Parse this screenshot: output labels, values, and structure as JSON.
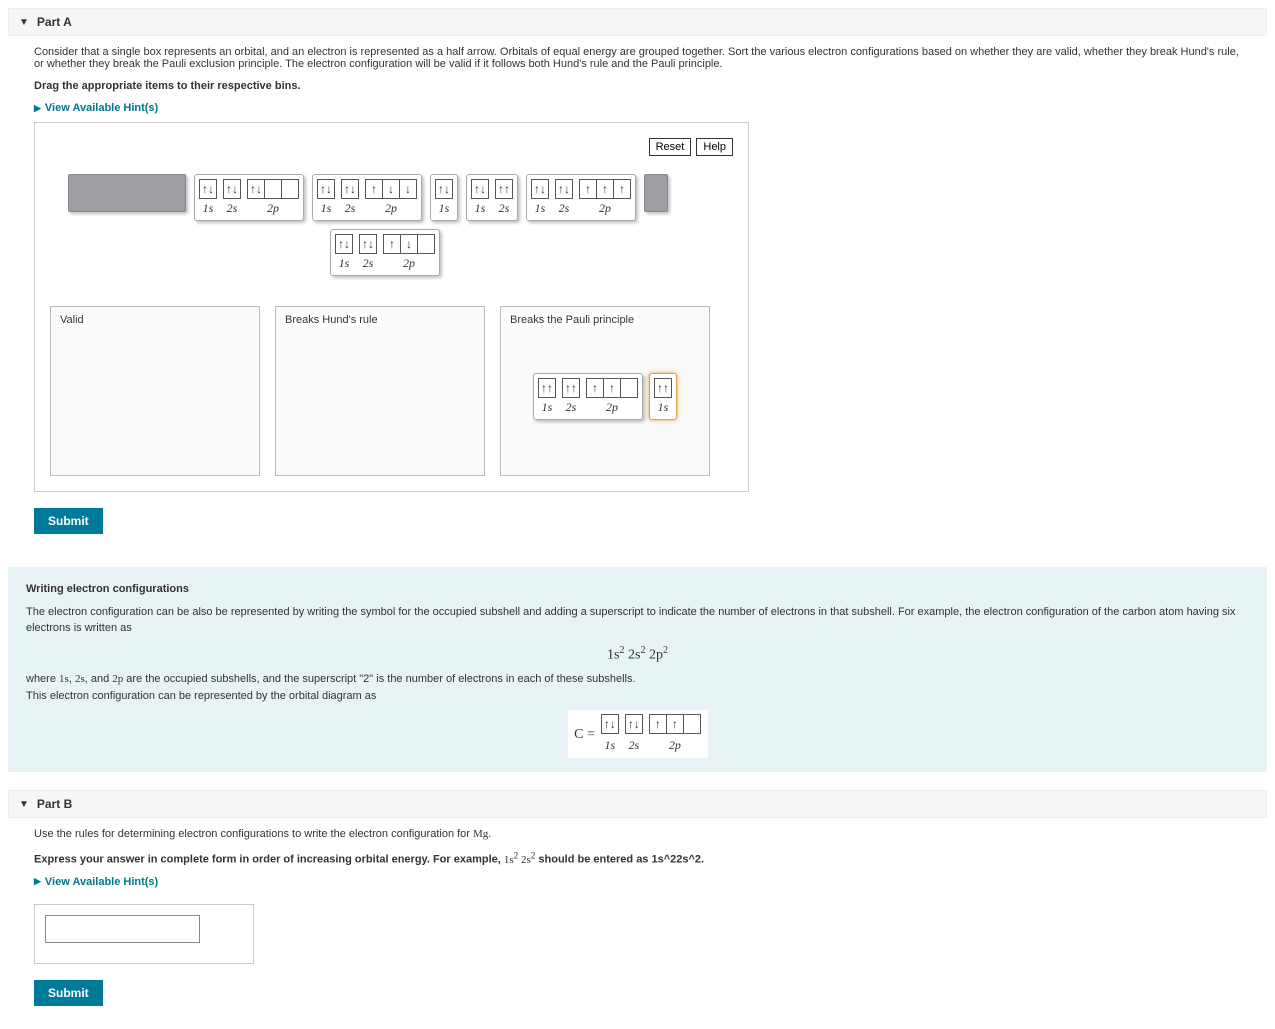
{
  "partA": {
    "title": "Part A",
    "prompt": "Consider that a single box represents an orbital, and an electron is represented as a half arrow. Orbitals of equal energy are grouped together. Sort the various electron configurations based on whether they are valid, whether they break Hund's rule, or whether they break the Pauli exclusion principle. The electron configuration will be valid if it follows both Hund's rule and the Pauli principle.",
    "instruction": "Drag the appropriate items to their respective bins.",
    "hint_label": "View Available Hint(s)",
    "reset_label": "Reset",
    "help_label": "Help",
    "bins": {
      "valid": "Valid",
      "hund": "Breaks Hund's rule",
      "pauli": "Breaks the Pauli principle"
    },
    "submit_label": "Submit"
  },
  "orbital_labels": {
    "s1": "1s",
    "s2": "2s",
    "p2": "2p"
  },
  "arrows": {
    "up": "↑",
    "down": "↓",
    "updown": "↑↓",
    "upup": "↑↑",
    "downdown": "↓↓"
  },
  "pool_items": [
    {
      "id": "cfg1",
      "shells": [
        {
          "label": "1s",
          "boxes": [
            "updown"
          ]
        },
        {
          "label": "2s",
          "boxes": [
            "updown"
          ]
        },
        {
          "label": "2p",
          "boxes": [
            "updown",
            "",
            ""
          ]
        }
      ]
    },
    {
      "id": "cfg2",
      "shells": [
        {
          "label": "1s",
          "boxes": [
            "updown"
          ]
        },
        {
          "label": "2s",
          "boxes": [
            "updown"
          ]
        },
        {
          "label": "2p",
          "boxes": [
            "up",
            "down",
            "down"
          ]
        }
      ]
    },
    {
      "id": "cfg3",
      "shells": [
        {
          "label": "1s",
          "boxes": [
            "updown"
          ]
        }
      ]
    },
    {
      "id": "cfg4",
      "shells": [
        {
          "label": "1s",
          "boxes": [
            "updown"
          ]
        },
        {
          "label": "2s",
          "boxes": [
            "upup"
          ]
        }
      ]
    },
    {
      "id": "cfg5",
      "shells": [
        {
          "label": "1s",
          "boxes": [
            "updown"
          ]
        },
        {
          "label": "2s",
          "boxes": [
            "updown"
          ]
        },
        {
          "label": "2p",
          "boxes": [
            "up",
            "up",
            "up"
          ]
        }
      ]
    },
    {
      "id": "cfg6",
      "shells": [
        {
          "label": "1s",
          "boxes": [
            "updown"
          ]
        },
        {
          "label": "2s",
          "boxes": [
            "updown"
          ]
        },
        {
          "label": "2p",
          "boxes": [
            "up",
            "down",
            ""
          ]
        }
      ]
    }
  ],
  "dropped_pauli": [
    {
      "id": "d1",
      "shells": [
        {
          "label": "1s",
          "boxes": [
            "upup"
          ]
        },
        {
          "label": "2s",
          "boxes": [
            "upup"
          ]
        },
        {
          "label": "2p",
          "boxes": [
            "up",
            "up",
            ""
          ]
        }
      ]
    },
    {
      "id": "d2",
      "selected": true,
      "shells": [
        {
          "label": "1s",
          "boxes": [
            "upup"
          ]
        }
      ]
    }
  ],
  "info": {
    "title": "Writing electron configurations",
    "p1": "The electron configuration can be also be represented by writing the symbol for the occupied subshell and adding a superscript to indicate the number of electrons in that subshell. For example, the electron configuration of the carbon atom having six electrons is written as",
    "eq_html": "1s<sup>2</sup> 2s<sup>2</sup> 2p<sup>2</sup>",
    "p2_pre": "where ",
    "p2_mid": ", and ",
    "p2_post": " are the occupied subshells, and the superscript \"2\" is the number of electrons in each of these subshells.",
    "p3": "This electron configuration can be represented by the orbital diagram as",
    "c_eq": "C ="
  },
  "partB": {
    "title": "Part B",
    "prompt_pre": "Use the rules for determining electron configurations to write the electron configuration for ",
    "element": "Mg",
    "instruction_pre": "Express your answer in complete form in order of increasing orbital energy. For example, ",
    "example_html": "1s<sup>2</sup> 2s<sup>2</sup>",
    "instruction_post": " should be entered as 1s^22s^2.",
    "hint_label": "View Available Hint(s)",
    "submit_label": "Submit",
    "answer_value": ""
  }
}
